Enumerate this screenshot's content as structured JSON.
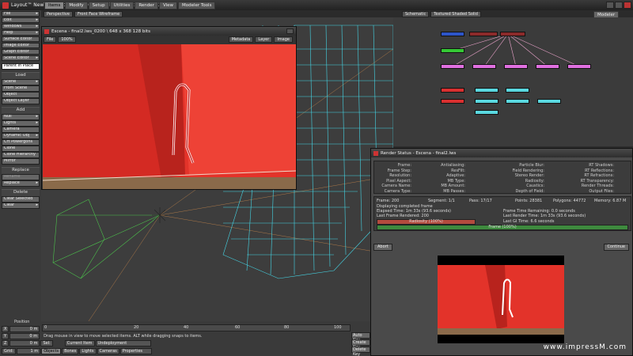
{
  "window": {
    "title": "Layout™ NewTek LightWave 3D ® 9.6  (Win32) - Escena - final2.lws",
    "tabs": [
      "Items",
      "Modify",
      "Setup",
      "Utilities",
      "Render",
      "View",
      "Modeler Tools"
    ],
    "active_tab": "Items",
    "modeler_button": "Modeler"
  },
  "left_panel": {
    "top_items": [
      "File",
      "Edit",
      "Windows",
      "Help",
      "Surface Editor",
      "Image Editor",
      "Graph Editor",
      "Scene Editor"
    ],
    "parent_in_place": "Parent in Place",
    "load_header": "Load",
    "load_items": [
      "Scene",
      "From Scene",
      "Object",
      "Object Layer"
    ],
    "add_header": "Add",
    "add_items": [
      "Null",
      "Lights",
      "Camera",
      "Dynamic Obj",
      "Crt Powergons",
      "Clone",
      "Clone Hierarchy",
      "Mirror"
    ],
    "replace_header": "Replace",
    "replace_items": [
      "Rename",
      "Replace"
    ],
    "delete_header": "Delete",
    "delete_items": [
      "Clear Selected",
      "Clear"
    ]
  },
  "main_viewport": {
    "view_mode": "Perspective",
    "render_mode": "Front Face Wireframe"
  },
  "schematic_viewport": {
    "view_mode": "Schematic",
    "render_mode": "Textured Shaded Solid"
  },
  "image_viewer": {
    "title": "Escena - final2.lws_0200 \\  648 x 368 128 bits",
    "file_menu": "File",
    "zoom": "100%",
    "metadata_button": "Metadata",
    "layer_menu": "Layer",
    "image_menu": "Image"
  },
  "render_status": {
    "title": "Render Status - Escena - final2.lws",
    "labels_col1": [
      "Frame:",
      "Frame Step:",
      "Resolution:",
      "Pixel Aspect:",
      "Camera Name:",
      "Camera Type:"
    ],
    "labels_col2": [
      "Antialiasing:",
      "ResFilt:",
      "Adaptive:",
      "MB Type:",
      "MB Amount:",
      "MB Passes:"
    ],
    "labels_col3": [
      "Particle Blur:",
      "Field Rendering:",
      "Stereo Render:",
      "Radiosity:",
      "Caustics:",
      "Depth of Field:"
    ],
    "labels_col4": [
      "RT Shadows:",
      "RT Reflections:",
      "RT Refractions:",
      "RT Transparency:",
      "Render Threads:",
      "Output Files:"
    ],
    "frame": "Frame: 200",
    "segment": "Segment: 1/1",
    "pass": "Pass: 17/17",
    "points": "Points: 28381",
    "polygons": "Polygons: 44772",
    "memory": "Memory: 6.87 M",
    "status_line": "Displaying completed frame",
    "elapsed": "Elapsed Time: 1m 33s (93.6 seconds)",
    "last_frame": "Last Frame Rendered: 200",
    "remaining": "Frame Time Remaining: 0.0 seconds",
    "last_render": "Last Render Time: 1m 33s (93.6 seconds)",
    "last_gi": "Last GI Time: 6.6 seconds",
    "radiosity_bar": "Radiosity (100%)",
    "radiosity_progress": 1.0,
    "frame_bar": "Frame (100%)",
    "frame_progress": 1.0,
    "abort_button": "Abort",
    "continue_button": "Continue"
  },
  "timeline": {
    "position_label": "Position",
    "ticks": [
      "0",
      "20",
      "40",
      "60",
      "80",
      "100"
    ],
    "row1_value": "0",
    "row1_unit": "m",
    "row2_value": "0",
    "row2_unit": "m",
    "row3_value": "0",
    "row3_unit": "m",
    "status_msg": "Drag mouse in view to move selected items. ALT while dragging snaps to items.",
    "auto_key": "Auto Key",
    "create_key": "Create Key",
    "delete_key": "Delete Key",
    "current_item_label": "Current Item",
    "current_item_value": "Undeployment",
    "sel_label": "Sel:",
    "objects_tab": "Objects",
    "bones_tab": "Bones",
    "lights_tab": "Lights",
    "cameras_tab": "Cameras",
    "properties_button": "Properties",
    "grid_label": "Grid:",
    "grid_value": "1 m",
    "left_fields": [
      "X",
      "Y",
      "Z"
    ]
  },
  "watermark": "www.impressM.com"
}
